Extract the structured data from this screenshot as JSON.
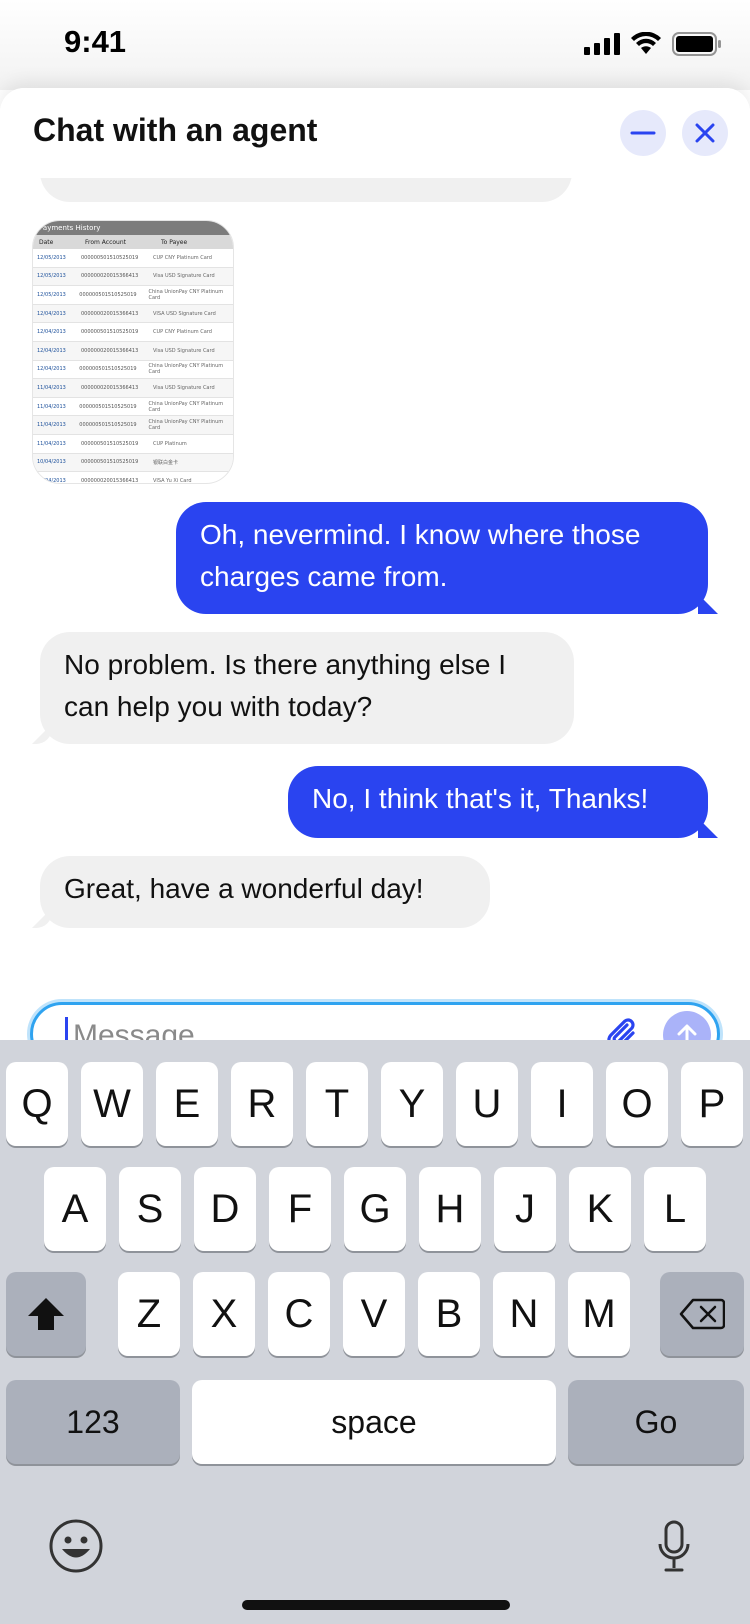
{
  "status_bar": {
    "time": "9:41",
    "icons": [
      "cellular-signal-icon",
      "wifi-icon",
      "battery-icon"
    ]
  },
  "chat": {
    "title": "Chat with an agent",
    "header_buttons": [
      "minimize-icon",
      "close-icon"
    ],
    "partial_message_text": "chat",
    "attachment": {
      "header": "Payments History",
      "columns": [
        "Date",
        "From Account",
        "To Payee"
      ],
      "rows": [
        [
          "12/05/2013",
          "000000501510525019",
          "CUP CNY Platinum Card"
        ],
        [
          "12/05/2013",
          "000000020015366413",
          "Visa USD Signature Card"
        ],
        [
          "12/05/2013",
          "000000501510525019",
          "China UnionPay CNY Platinum Card"
        ],
        [
          "12/04/2013",
          "000000020015366413",
          "VISA USD Signature Card"
        ],
        [
          "12/04/2013",
          "000000501510525019",
          "CUP CNY Platinum Card"
        ],
        [
          "12/04/2013",
          "000000020015366413",
          "Visa USD Signature Card"
        ],
        [
          "12/04/2013",
          "000000501510525019",
          "China UnionPay CNY Platinum Card"
        ],
        [
          "11/04/2013",
          "000000020015366413",
          "Visa USD Signature Card"
        ],
        [
          "11/04/2013",
          "000000501510525019",
          "China UnionPay CNY Platinum Card"
        ],
        [
          "11/04/2013",
          "000000501510525019",
          "China UnionPay CNY Platinum Card"
        ],
        [
          "11/04/2013",
          "000000501510525019",
          "CUP Platinum"
        ],
        [
          "10/04/2013",
          "000000501510525019",
          "银联白金卡"
        ],
        [
          "09/04/2013",
          "000000020015366413",
          "VISA Yu Xi Card"
        ],
        [
          "09/04/2013",
          "000000020015366413",
          "VISA Yu Xi Card"
        ]
      ]
    },
    "messages": [
      {
        "sender": "user",
        "text": "Oh, nevermind. I know where those charges came from."
      },
      {
        "sender": "agent",
        "text": "No problem. Is there anything else I can help you with today?"
      },
      {
        "sender": "user",
        "text": "No, I think that's it, Thanks!"
      },
      {
        "sender": "agent",
        "text": "Great, have a wonderful day!"
      }
    ],
    "input": {
      "placeholder": "Message",
      "value": ""
    },
    "input_buttons": [
      "paperclip-icon",
      "send-arrow-icon"
    ]
  },
  "keyboard": {
    "row1": [
      "Q",
      "W",
      "E",
      "R",
      "T",
      "Y",
      "U",
      "I",
      "O",
      "P"
    ],
    "row2": [
      "A",
      "S",
      "D",
      "F",
      "G",
      "H",
      "J",
      "K",
      "L"
    ],
    "row3": [
      "Z",
      "X",
      "C",
      "V",
      "B",
      "N",
      "M"
    ],
    "numbers_label": "123",
    "space_label": "space",
    "go_label": "Go",
    "icons": [
      "shift-icon",
      "backspace-icon",
      "emoji-icon",
      "microphone-icon"
    ]
  },
  "colors": {
    "accent": "#2A44F0",
    "agent_bubble": "#F0F0F0",
    "input_border": "#2FA3F0",
    "keyboard_bg": "#D1D4DB"
  }
}
